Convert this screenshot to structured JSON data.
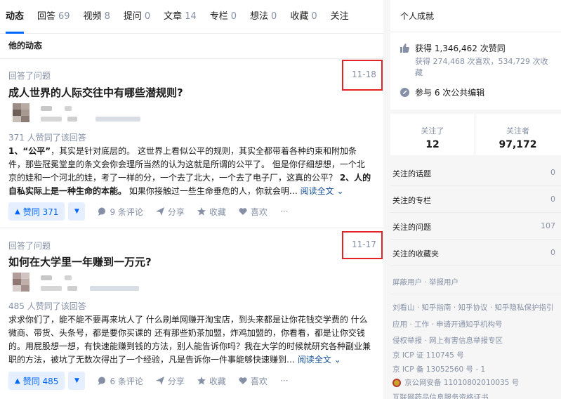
{
  "tabs": [
    {
      "label": "动态",
      "count": ""
    },
    {
      "label": "回答",
      "count": "69"
    },
    {
      "label": "视频",
      "count": "8"
    },
    {
      "label": "提问",
      "count": "0"
    },
    {
      "label": "文章",
      "count": "14"
    },
    {
      "label": "专栏",
      "count": "0"
    },
    {
      "label": "想法",
      "count": "0"
    },
    {
      "label": "收藏",
      "count": "0"
    },
    {
      "label": "关注",
      "count": ""
    }
  ],
  "section_title": "他的动态",
  "feed": [
    {
      "meta": "回答了问题",
      "date": "11-18",
      "title": "成人世界的人际交往中有哪些潜规则?",
      "voters": "371 人赞同了该回答",
      "excerpt_bold1": "1、“公平”",
      "excerpt_mid": "，其实是针对底层的。 这世界上看似公平的规则，其实全都带着各种约束和附加条件，那些冠冕堂皇的条文会你会理所当然的认为这就是所谓的公平了。 但是你仔细想想，一个北京的娃和一个河北的娃，考了一样的分，一个去了北大，一个去了电子厂，这真的公平？ ",
      "excerpt_bold2": "2、人的自私实际上是一种生命的本能。",
      "excerpt_tail": " 如果你接触过一些生命垂危的人，你就会明… ",
      "read_more": "阅读全文",
      "vote_label": "赞同 371",
      "comments": "9 条评论",
      "share": "分享",
      "collect": "收藏",
      "like": "喜欢",
      "more": "···"
    },
    {
      "meta": "回答了问题",
      "date": "11-17",
      "title": "如何在大学里一年赚到一万元?",
      "voters": "485 人赞同了该回答",
      "excerpt_bold1": "",
      "excerpt_mid": "求求你们了，能不能不要再来坑人了 什么刷单网赚开淘宝店，到头来都是让你花钱交学费的 什么微商、带货、头条号，都是要你买课的 还有那些奶茶加盟，炸鸡加盟的，你看看，都是让你交钱的。用屁股想一想，有快速能赚到钱的方法，别人能告诉你吗？我在大学的时候就研究各种副业兼职的方法，被坑了无数次得出了一个经验，凡是告诉你一件事能够快速赚到… ",
      "excerpt_bold2": "",
      "excerpt_tail": "",
      "read_more": "阅读全文",
      "vote_label": "赞同 485",
      "comments": "6 条评论",
      "share": "分享",
      "collect": "收藏",
      "like": "喜欢",
      "more": "···"
    }
  ],
  "achievements": {
    "title": "个人成就",
    "upvotes": "获得 1,346,462 次赞同",
    "likes_sub": "获得 274,468 次喜欢，534,729 次收藏",
    "edits": "参与 6 次公共编辑"
  },
  "follow": {
    "following_label": "关注了",
    "following_count": "12",
    "followers_label": "关注者",
    "followers_count": "97,172"
  },
  "lists": [
    {
      "label": "关注的话题",
      "value": "0"
    },
    {
      "label": "关注的专栏",
      "value": "0"
    },
    {
      "label": "关注的问题",
      "value": "107"
    },
    {
      "label": "关注的收藏夹",
      "value": "0"
    }
  ],
  "footer": {
    "block": "屏蔽用户 · 举报用户",
    "links1": "刘看山 · 知乎指南 · 知乎协议 · 知乎隐私保护指引",
    "links2": "应用 · 工作 · 申请开通知乎机构号",
    "links3": "侵权举报 · 网上有害信息举报专区",
    "icp1": "京 ICP 证 110745 号",
    "icp2": "京 ICP 备 13052560 号 - 1",
    "police": "京公网安备 11010802010035 号",
    "cut": "互联网药品信息服务资格证书"
  },
  "colors": {
    "accent": "#0066ff",
    "highlight_box": "#e32228"
  }
}
